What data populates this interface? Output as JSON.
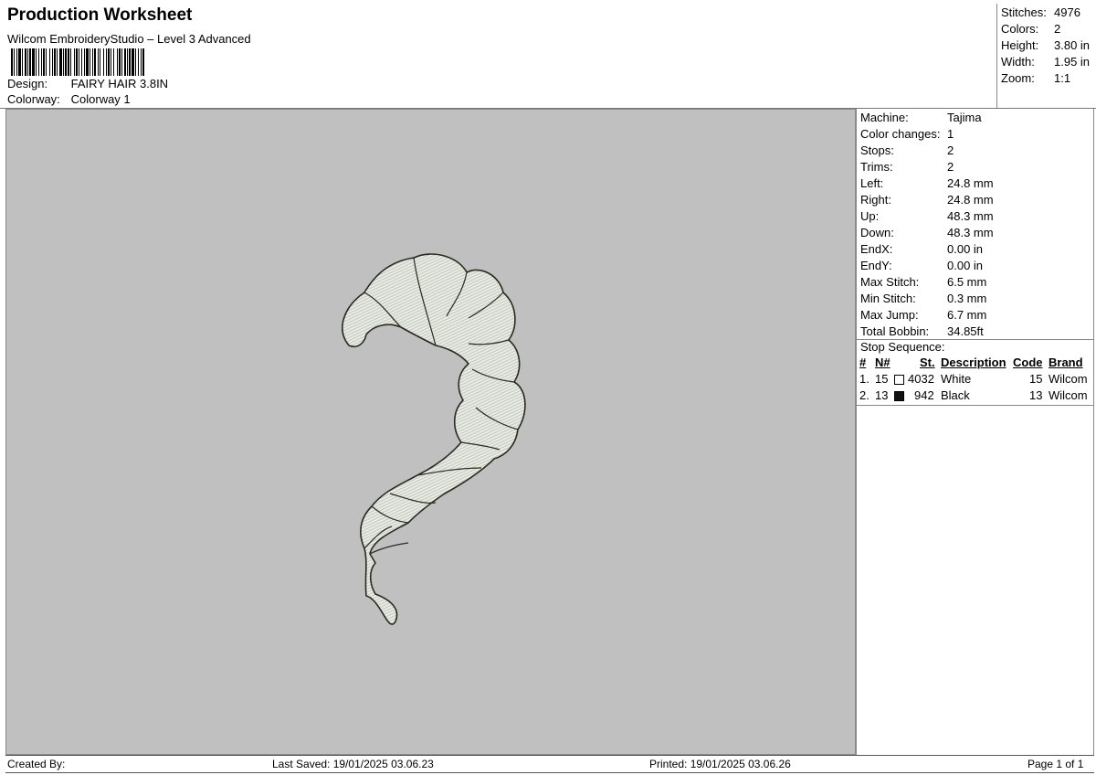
{
  "header": {
    "title": "Production Worksheet",
    "subtitle": "Wilcom EmbroideryStudio – Level 3 Advanced",
    "design_label": "Design:",
    "design_value": "FAIRY HAIR 3.8IN",
    "colorway_label": "Colorway:",
    "colorway_value": "Colorway 1"
  },
  "summary": [
    {
      "label": "Stitches:",
      "value": "4976"
    },
    {
      "label": "Colors:",
      "value": "2"
    },
    {
      "label": "Height:",
      "value": "3.80 in"
    },
    {
      "label": "Width:",
      "value": "1.95 in"
    },
    {
      "label": "Zoom:",
      "value": "1:1"
    }
  ],
  "machine_info": [
    {
      "label": "Machine:",
      "value": "Tajima"
    },
    {
      "label": "Color changes:",
      "value": "1"
    },
    {
      "label": "Stops:",
      "value": "2"
    },
    {
      "label": "Trims:",
      "value": "2"
    },
    {
      "label": "Left:",
      "value": "24.8 mm"
    },
    {
      "label": "Right:",
      "value": "24.8 mm"
    },
    {
      "label": "Up:",
      "value": "48.3 mm"
    },
    {
      "label": "Down:",
      "value": "48.3 mm"
    },
    {
      "label": "EndX:",
      "value": "0.00 in"
    },
    {
      "label": "EndY:",
      "value": "0.00 in"
    },
    {
      "label": "Max Stitch:",
      "value": "6.5 mm"
    },
    {
      "label": "Min Stitch:",
      "value": "0.3 mm"
    },
    {
      "label": "Max Jump:",
      "value": "6.7 mm"
    },
    {
      "label": "Total Bobbin:",
      "value": "34.85ft"
    }
  ],
  "stop_sequence": {
    "title": "Stop Sequence:",
    "columns": {
      "num": "#",
      "n": "N#",
      "st": "St.",
      "description": "Description",
      "code": "Code",
      "brand": "Brand"
    },
    "rows": [
      {
        "num": "1.",
        "n": "15",
        "swatch": "#ffffff",
        "st": "4032",
        "description": "White",
        "code": "15",
        "brand": "Wilcom"
      },
      {
        "num": "2.",
        "n": "13",
        "swatch": "#111111",
        "st": "942",
        "description": "Black",
        "code": "13",
        "brand": "Wilcom"
      }
    ]
  },
  "design_colors": {
    "fill": "#e6ebe2",
    "outline": "#2a2a22",
    "background": "#c0c0c0"
  },
  "footer": {
    "created_by": "Created By:",
    "last_saved": "Last Saved: 19/01/2025 03.06.23",
    "printed": "Printed: 19/01/2025 03.06.26",
    "page": "Page 1 of 1"
  }
}
